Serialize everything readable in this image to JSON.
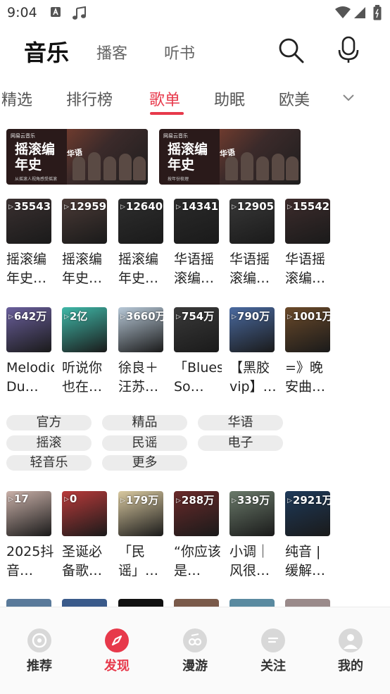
{
  "status": {
    "time": "9:04"
  },
  "topnav": {
    "tab_music": "音乐",
    "tab_podcast": "播客",
    "tab_audiobook": "听书"
  },
  "categories": [
    "精选",
    "排行榜",
    "歌单",
    "助眠",
    "欧美"
  ],
  "categories_active": "歌单",
  "banners": [
    {
      "brand": "网易云音乐",
      "title": "摇滚编年史",
      "badge": "华语",
      "subtitle": "从摇滚人视角感受摇滚"
    },
    {
      "brand": "网易云音乐",
      "title": "摇滚编年史",
      "badge": "华语",
      "subtitle": "按年份梳理"
    }
  ],
  "row1": [
    {
      "count": "35543",
      "title": "摇滚编年史…",
      "color": "#3a3030"
    },
    {
      "count": "12959",
      "title": "摇滚编年史…",
      "color": "#4a3a36"
    },
    {
      "count": "12640",
      "title": "摇滚编年史…",
      "color": "#2e2e2e"
    },
    {
      "count": "14341",
      "title": "华语摇滚编…",
      "color": "#2a2a2a"
    },
    {
      "count": "12905",
      "title": "华语摇滚编…",
      "color": "#383838"
    },
    {
      "count": "15542",
      "title": "华语摇滚编…",
      "color": "#3d2c2c"
    }
  ],
  "row2": [
    {
      "count": "642万",
      "title": "Melodic Du…",
      "color": "#6a5f9c"
    },
    {
      "count": "2亿",
      "title": "听说你也在…",
      "color": "#3fb8a8"
    },
    {
      "count": "3660万",
      "title": "徐良＋汪苏…",
      "color": "#b8c9d8"
    },
    {
      "count": "754万",
      "title": "「Blues So…",
      "color": "#3a3a3a"
    },
    {
      "count": "790万",
      "title": "【黑胶vip】…",
      "color": "#4a6aa0"
    },
    {
      "count": "1001万",
      "title": "=》晚安曲…",
      "color": "#6b4a2a"
    }
  ],
  "tags": [
    "官方",
    "精品",
    "华语",
    "摇滚",
    "民谣",
    "电子",
    "轻音乐",
    "更多"
  ],
  "row3": [
    {
      "count": "17",
      "title": "2025抖音…",
      "color": "#c9b0a8"
    },
    {
      "count": "0",
      "title": "圣诞必备歌…",
      "color": "#b83a3a"
    },
    {
      "count": "179万",
      "title": "「民谣」…",
      "color": "#d9c9a0"
    },
    {
      "count": "288万",
      "title": "“你应该是…",
      "color": "#6a2a2a"
    },
    {
      "count": "339万",
      "title": "小调｜风很…",
      "color": "#6a7a6a"
    },
    {
      "count": "2921万",
      "title": "纯音 | 缓解…",
      "color": "#1e3a5a"
    }
  ],
  "strip_colors": [
    "#5a7a9a",
    "#3a5a8a",
    "#111111",
    "#7a5a4a",
    "#5a8aa0",
    "#9a8a8a"
  ],
  "bottom_nav": [
    {
      "label": "推荐",
      "icon": "vinyl-icon",
      "active": false
    },
    {
      "label": "发现",
      "icon": "compass-icon",
      "active": true
    },
    {
      "label": "漫游",
      "icon": "radio-icon",
      "active": false
    },
    {
      "label": "关注",
      "icon": "chat-icon",
      "active": false
    },
    {
      "label": "我的",
      "icon": "user-icon",
      "active": false
    }
  ],
  "accent": "#e7394b"
}
